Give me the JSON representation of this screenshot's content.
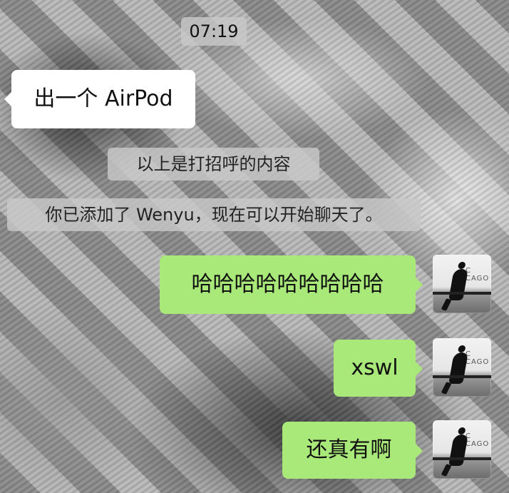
{
  "chat": {
    "timestamp": "07:19",
    "incoming": {
      "text": "出一个 AirPod"
    },
    "system_messages": [
      "以上是打招呼的内容",
      "你已添加了 Wenyu，现在可以开始聊天了。"
    ],
    "outgoing": [
      {
        "text": "哈哈哈哈哈哈哈哈哈"
      },
      {
        "text": "xswl"
      },
      {
        "text": "还真有啊"
      }
    ],
    "colors": {
      "incoming_bubble": "#ffffff",
      "outgoing_bubble": "#a9e97a",
      "system_pill": "#c8c8c8"
    }
  }
}
